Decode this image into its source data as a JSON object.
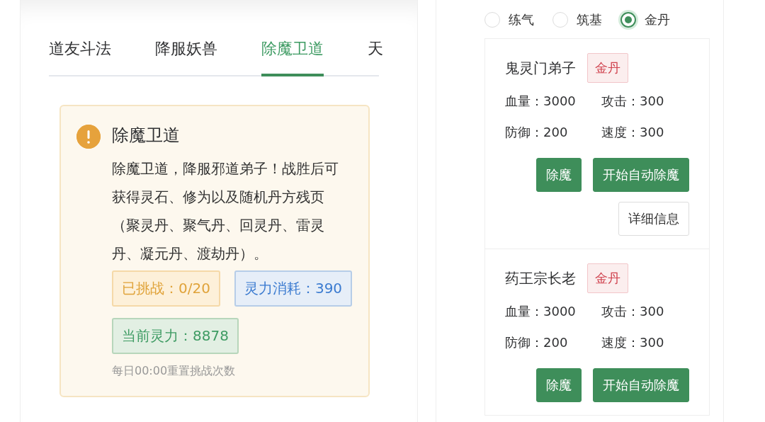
{
  "tabs": [
    {
      "label": "道友斗法",
      "selected": false
    },
    {
      "label": "降服妖兽",
      "selected": false
    },
    {
      "label": "除魔卫道",
      "selected": true
    },
    {
      "label": "天",
      "selected": false
    }
  ],
  "alert": {
    "title": "除魔卫道",
    "text": "除魔卫道，降服邪道弟子！战胜后可获得灵石、修为以及随机丹方残页（聚灵丹、聚气丹、回灵丹、雷灵丹、凝元丹、渡劫丹）。",
    "badges": [
      {
        "text": "已挑战：0/20",
        "kind": "warning"
      },
      {
        "text": "灵力消耗：390",
        "kind": "info"
      },
      {
        "text": "当前灵力：8878",
        "kind": "success"
      }
    ],
    "note": "每日00:00重置挑战次数"
  },
  "realms": [
    {
      "label": "练气",
      "selected": false
    },
    {
      "label": "筑基",
      "selected": false
    },
    {
      "label": "金丹",
      "selected": true
    }
  ],
  "enemies": [
    {
      "name": "鬼灵门弟子",
      "tag": "金丹",
      "stats": [
        "血量：3000",
        "攻击：300",
        "防御：200",
        "速度：300"
      ],
      "buttons": [
        {
          "label": "除魔",
          "kind": "primary"
        },
        {
          "label": "开始自动除魔",
          "kind": "primary"
        },
        {
          "label": "详细信息",
          "kind": "plain"
        }
      ]
    },
    {
      "name": "药王宗长老",
      "tag": "金丹",
      "stats": [
        "血量：3000",
        "攻击：300",
        "防御：200",
        "速度：300"
      ],
      "buttons": [
        {
          "label": "除魔",
          "kind": "primary"
        },
        {
          "label": "开始自动除魔",
          "kind": "primary"
        }
      ]
    }
  ]
}
